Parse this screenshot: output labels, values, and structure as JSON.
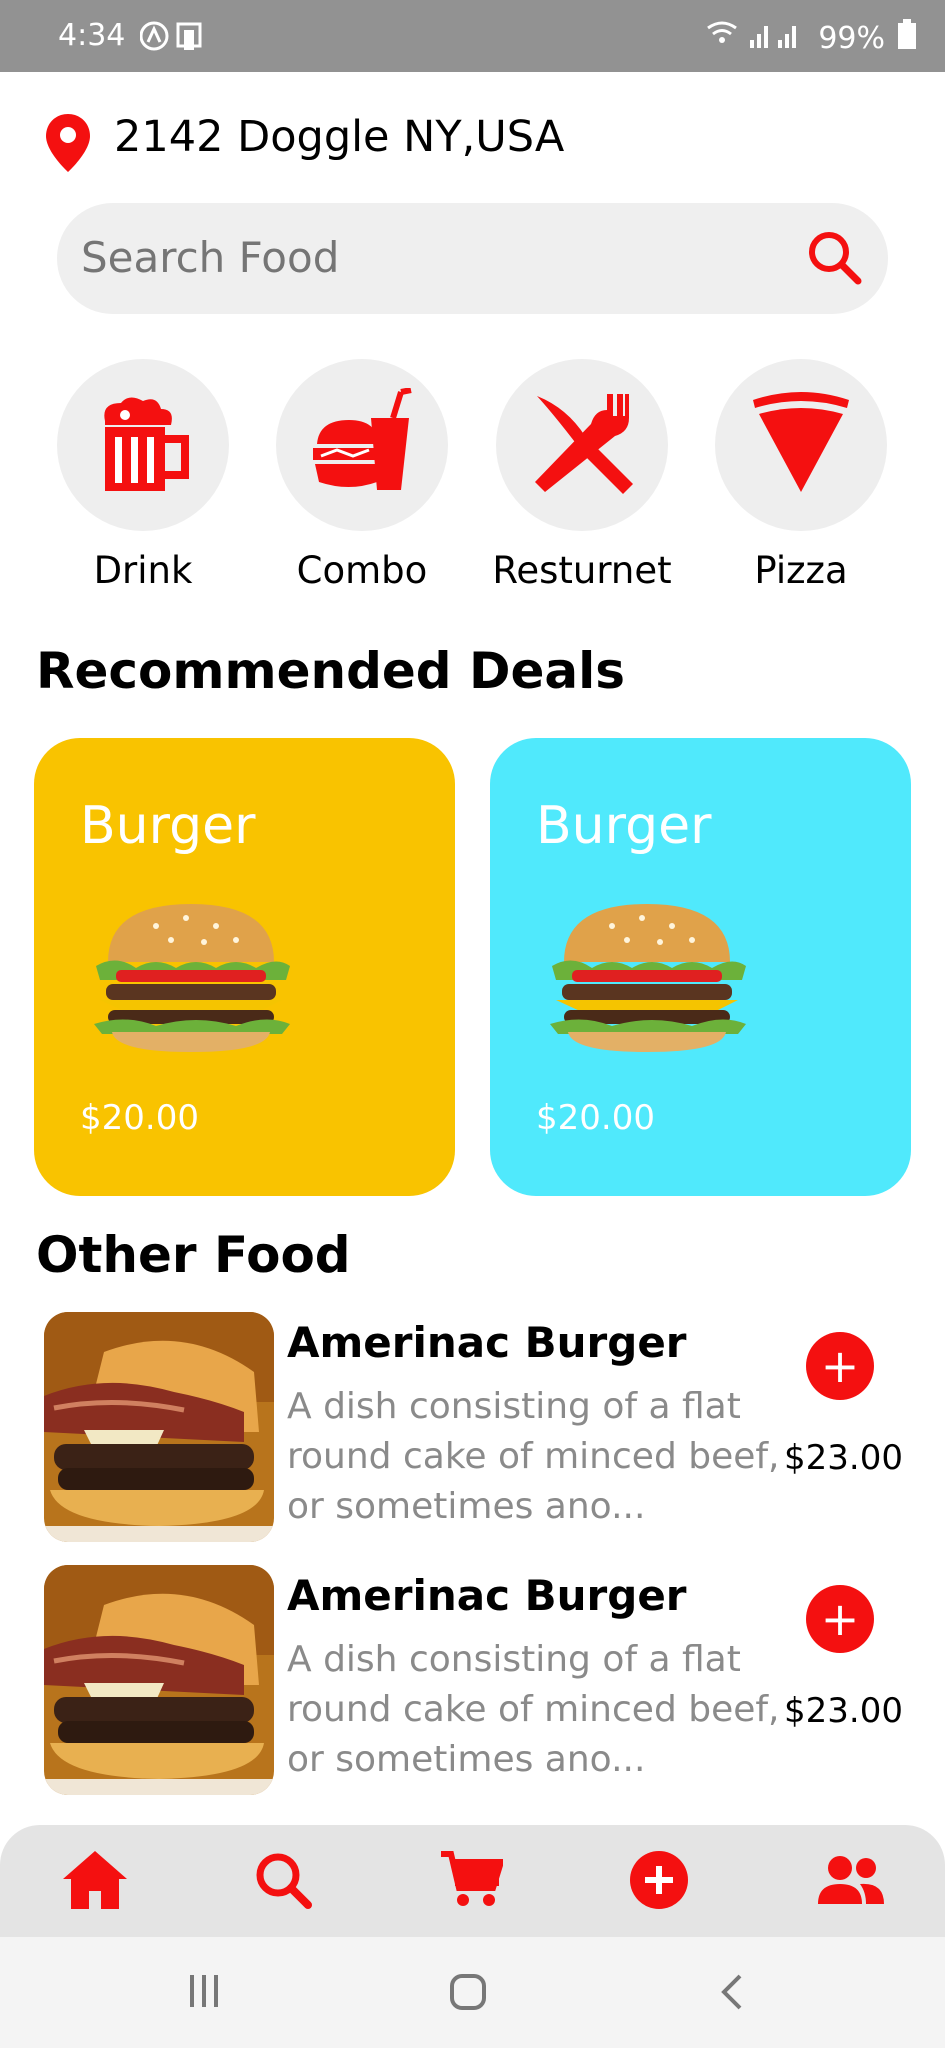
{
  "status_bar": {
    "time": "4:34",
    "battery": "99%"
  },
  "location": {
    "address": "2142 Doggle NY,USA"
  },
  "search": {
    "placeholder": "Search Food"
  },
  "categories": [
    {
      "label": "Drink",
      "icon": "beer-mug-icon"
    },
    {
      "label": "Combo",
      "icon": "burger-drink-combo-icon"
    },
    {
      "label": "Resturnet",
      "icon": "fork-knife-icon"
    },
    {
      "label": "Pizza",
      "icon": "pizza-slice-icon"
    }
  ],
  "recommended": {
    "heading": "Recommended Deals",
    "deals": [
      {
        "title": "Burger",
        "price": "$20.00",
        "color": "#f9c300"
      },
      {
        "title": "Burger",
        "price": "$20.00",
        "color": "#50e9fc"
      }
    ]
  },
  "other_food": {
    "heading": "Other Food",
    "items": [
      {
        "name": "Amerinac Burger",
        "description": "A dish consisting of a flat round cake of minced beef, or sometimes ano...",
        "price": "$23.00"
      },
      {
        "name": "Amerinac Burger",
        "description": "A dish consisting of a flat round cake of minced beef, or sometimes ano...",
        "price": "$23.00"
      }
    ]
  },
  "bottom_nav": [
    "home-icon",
    "search-icon",
    "cart-icon",
    "add-circle-icon",
    "users-icon"
  ],
  "colors": {
    "accent": "#f41010",
    "deal_yellow": "#f9c300",
    "deal_cyan": "#50e9fc"
  }
}
